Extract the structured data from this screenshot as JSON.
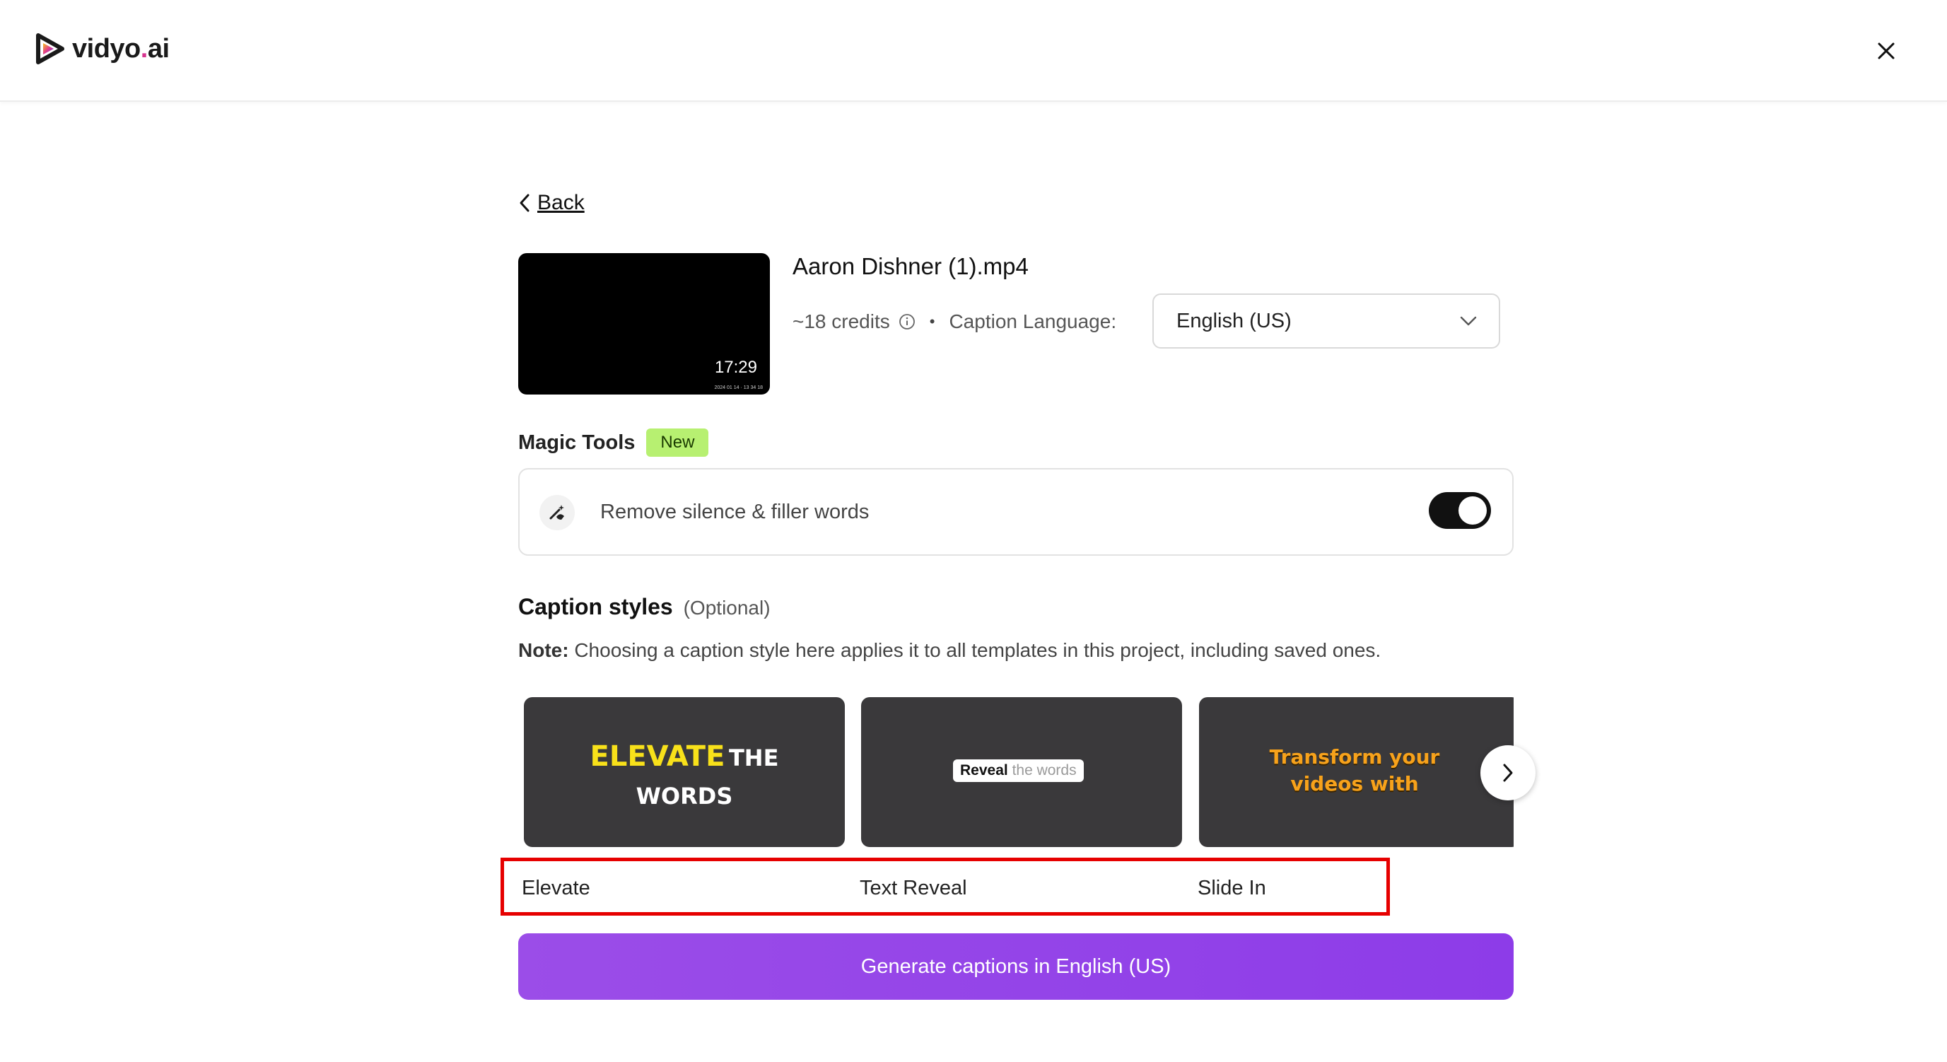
{
  "header": {
    "logo_text_a": "vidyo",
    "logo_text_dot": ".",
    "logo_text_b": "ai",
    "close_icon": "close-icon"
  },
  "nav": {
    "back_label": "Back"
  },
  "video": {
    "filename": "Aaron Dishner (1).mp4",
    "duration": "17:29",
    "timestamp": "2024 01 14 · 13 34 18",
    "credits": "~18 credits",
    "caption_language_label": "Caption Language:",
    "caption_language_value": "English (US)"
  },
  "magic_tools": {
    "title": "Magic Tools",
    "badge": "New",
    "option_label": "Remove silence & filler words",
    "option_enabled": true
  },
  "caption_styles": {
    "title": "Caption styles",
    "optional": "(Optional)",
    "note_bold": "Note:",
    "note_text": " Choosing a caption style here applies it to all templates in this project, including saved ones.",
    "cards": [
      {
        "name": "Elevate",
        "preview_a": "ELEVATE",
        "preview_b": "THE",
        "preview_c": "WORDS"
      },
      {
        "name": "Text Reveal",
        "preview_a": "Reveal",
        "preview_b": "the words"
      },
      {
        "name": "Slide In",
        "preview_a": "Transform your",
        "preview_b": "videos with"
      }
    ]
  },
  "actions": {
    "generate_label": "Generate captions in English (US)"
  },
  "colors": {
    "accent": "#9b4de8",
    "badge": "#b7f071",
    "highlight": "#e60000"
  }
}
